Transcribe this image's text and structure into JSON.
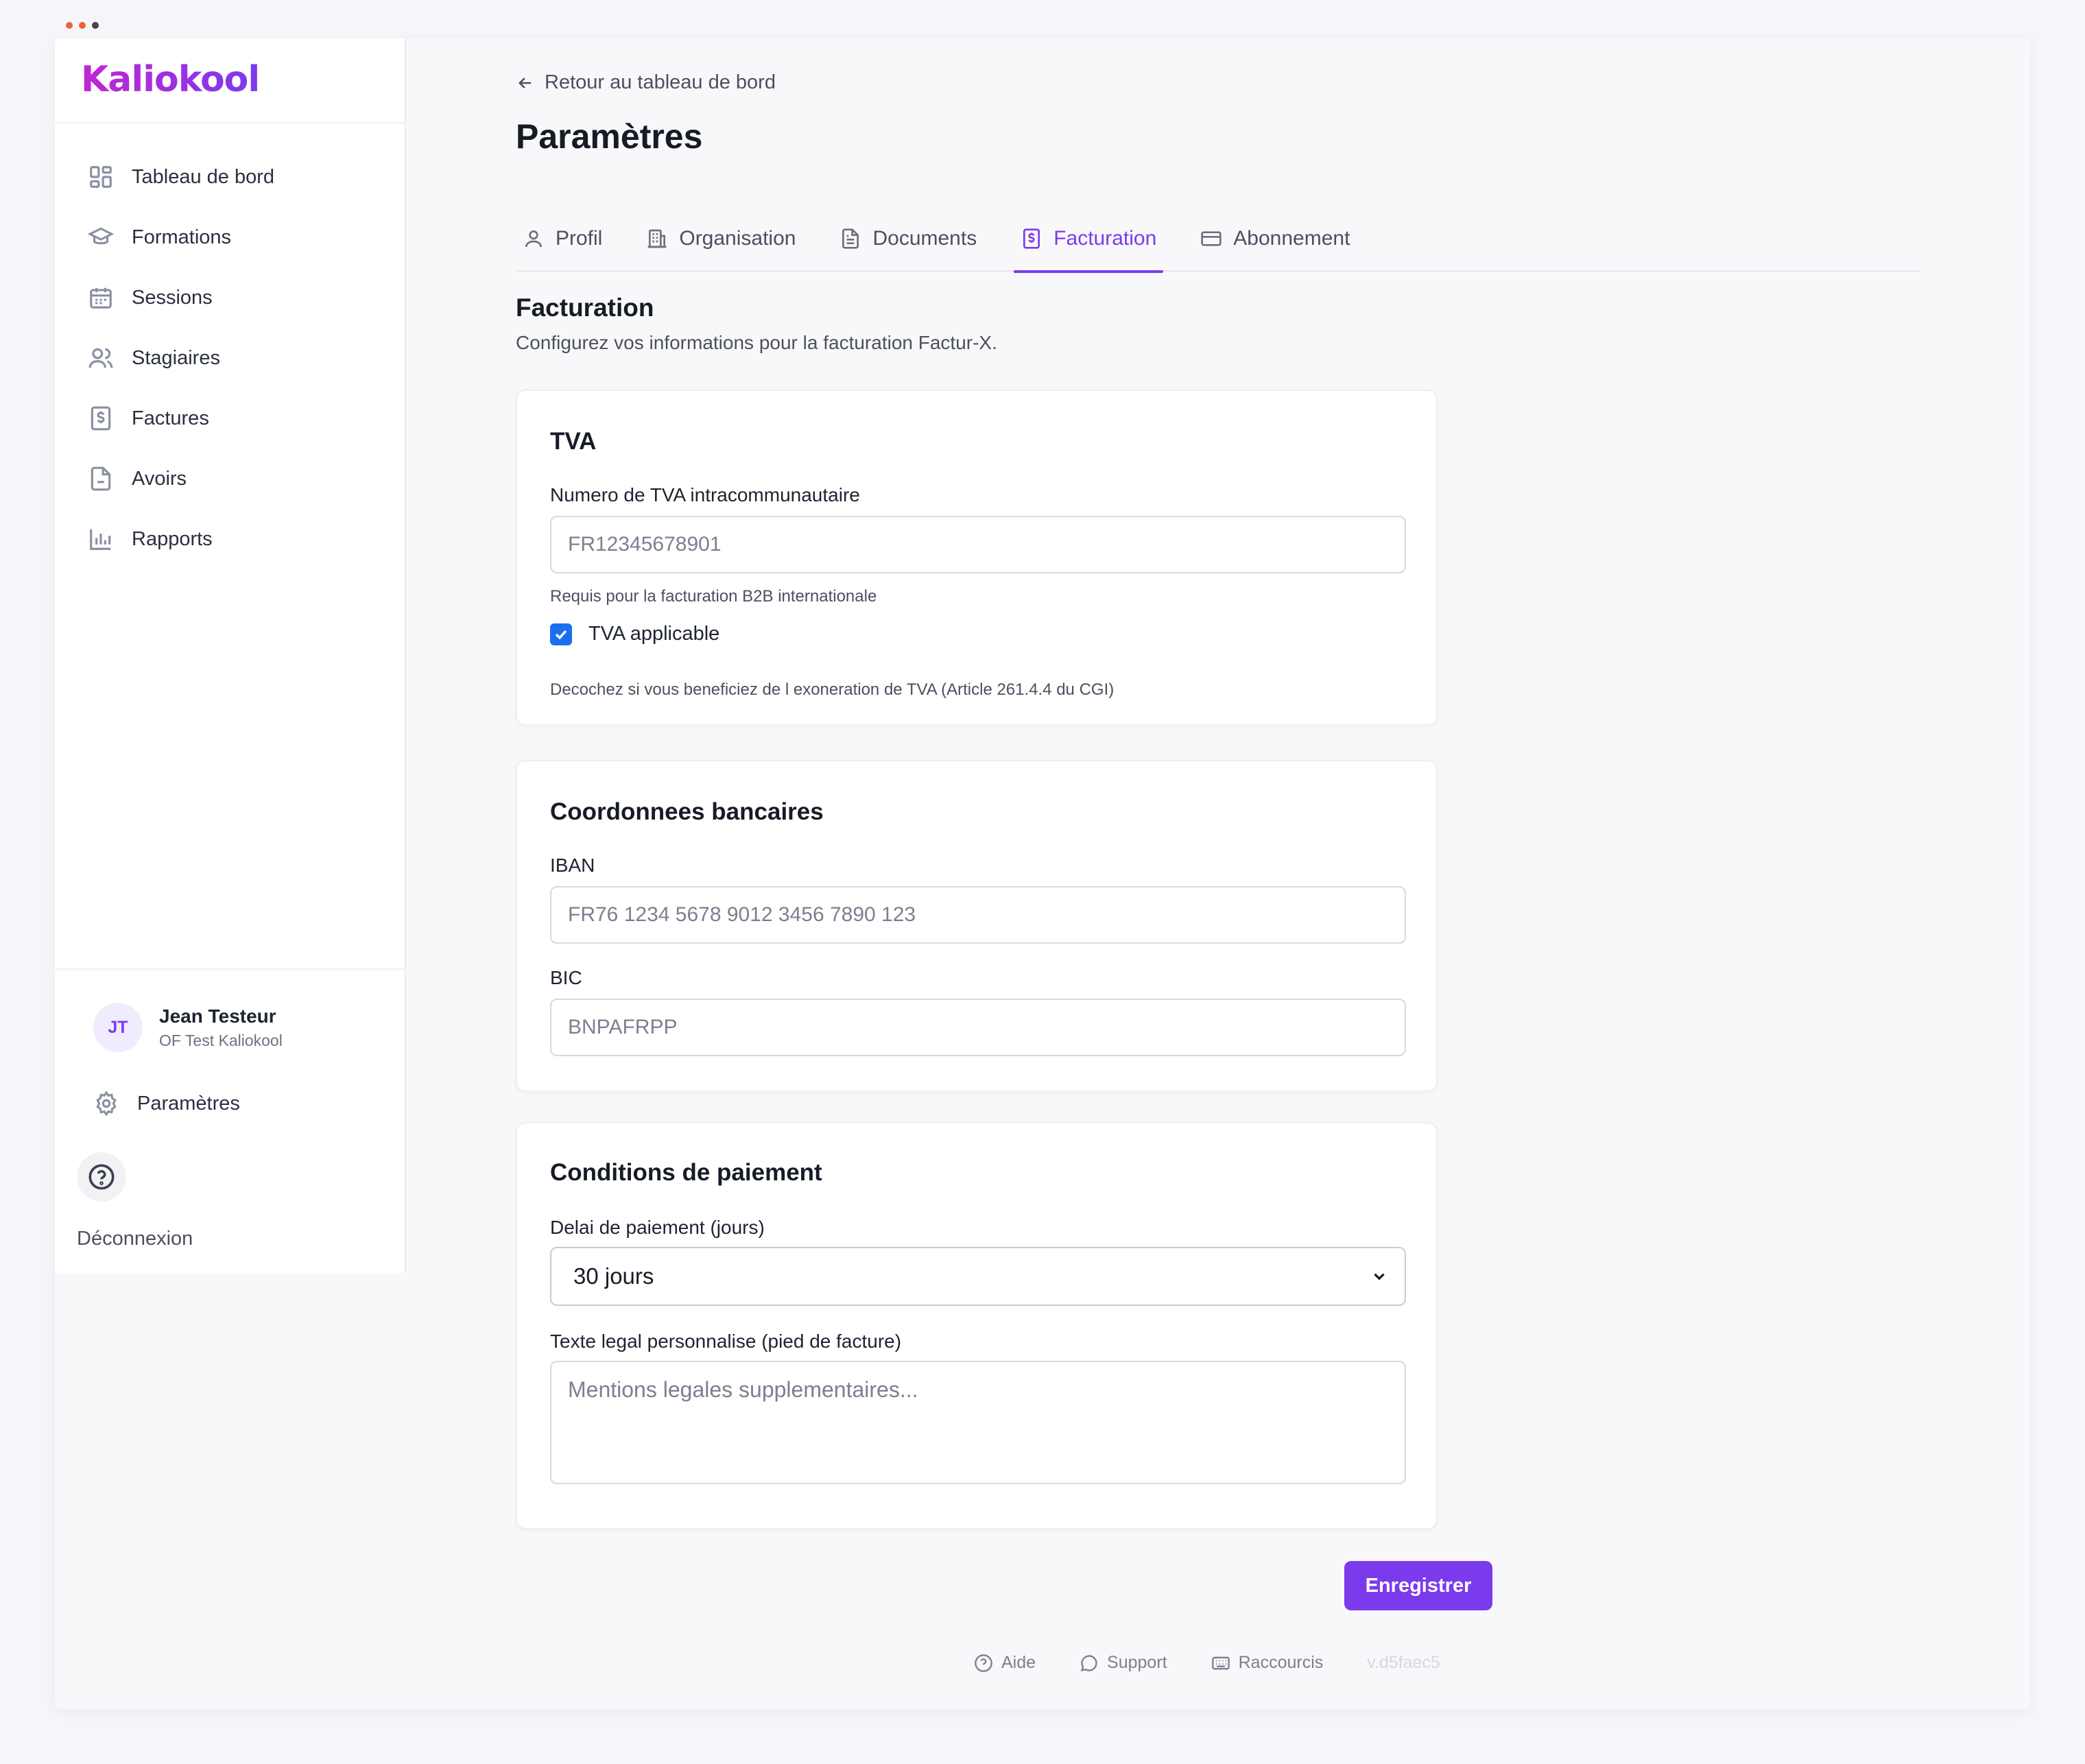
{
  "colors": {
    "accent": "#7c3aed",
    "checkbox": "#1a6ef0",
    "window_dots": [
      "#e8673a",
      "#e8673a",
      "#444444"
    ]
  },
  "app": {
    "logo_text": "Kaliokool"
  },
  "sidebar": {
    "items": [
      {
        "label": "Tableau de bord",
        "icon": "dashboard-icon"
      },
      {
        "label": "Formations",
        "icon": "graduation-cap-icon"
      },
      {
        "label": "Sessions",
        "icon": "calendar-icon"
      },
      {
        "label": "Stagiaires",
        "icon": "users-icon"
      },
      {
        "label": "Factures",
        "icon": "invoice-dollar-icon"
      },
      {
        "label": "Avoirs",
        "icon": "file-icon"
      },
      {
        "label": "Rapports",
        "icon": "bar-chart-icon"
      }
    ],
    "user": {
      "initials": "JT",
      "name": "Jean Testeur",
      "org": "OF Test Kaliokool"
    },
    "settings_label": "Paramètres",
    "logout_label": "Déconnexion"
  },
  "header": {
    "back_label": "Retour au tableau de bord",
    "title": "Paramètres"
  },
  "tabs": [
    {
      "label": "Profil",
      "icon": "user-icon",
      "active": false
    },
    {
      "label": "Organisation",
      "icon": "building-icon",
      "active": false
    },
    {
      "label": "Documents",
      "icon": "document-icon",
      "active": false
    },
    {
      "label": "Facturation",
      "icon": "invoice-dollar-icon",
      "active": true
    },
    {
      "label": "Abonnement",
      "icon": "credit-card-icon",
      "active": false
    }
  ],
  "section": {
    "title": "Facturation",
    "description": "Configurez vos informations pour la facturation Factur-X."
  },
  "tva": {
    "title": "TVA",
    "vat_label": "Numero de TVA intracommunautaire",
    "vat_placeholder": "FR12345678901",
    "vat_hint": "Requis pour la facturation B2B internationale",
    "applicable_label": "TVA applicable",
    "applicable_checked": true,
    "applicable_hint": "Decochez si vous beneficiez de l exoneration de TVA (Article 261.4.4 du CGI)"
  },
  "bank": {
    "title": "Coordonnees bancaires",
    "iban_label": "IBAN",
    "iban_placeholder": "FR76 1234 5678 9012 3456 7890 123",
    "bic_label": "BIC",
    "bic_placeholder": "BNPAFRPP"
  },
  "payment": {
    "title": "Conditions de paiement",
    "delay_label": "Delai de paiement (jours)",
    "delay_value": "30 jours",
    "legal_label": "Texte legal personnalise (pied de facture)",
    "legal_placeholder": "Mentions legales supplementaires..."
  },
  "save_label": "Enregistrer",
  "footer": {
    "help": "Aide",
    "support": "Support",
    "shortcuts": "Raccourcis",
    "version": "v.d5faec5"
  }
}
